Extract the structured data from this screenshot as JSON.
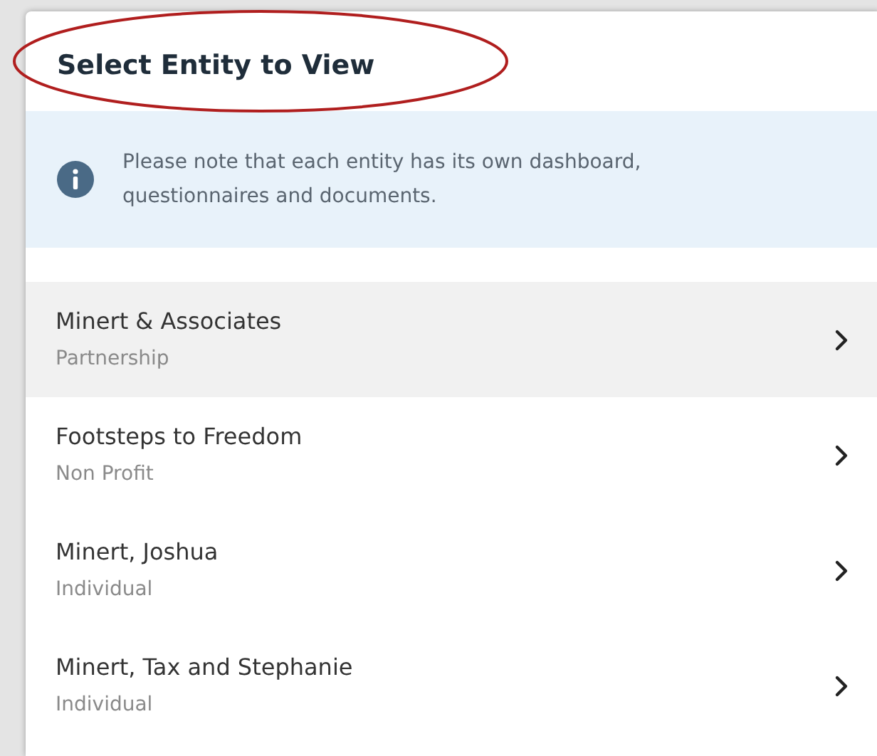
{
  "dialog": {
    "title": "Select Entity to View",
    "annotation_circled": true
  },
  "notice": {
    "text": "Please note that each entity has its own dashboard, questionnaires and documents."
  },
  "entities": [
    {
      "name": "Minert & Associates",
      "type": "Partnership",
      "selected": true
    },
    {
      "name": "Footsteps to Freedom",
      "type": "Non Profit",
      "selected": false
    },
    {
      "name": "Minert, Joshua",
      "type": "Individual",
      "selected": false
    },
    {
      "name": "Minert, Tax and Stephanie",
      "type": "Individual",
      "selected": false
    }
  ]
}
